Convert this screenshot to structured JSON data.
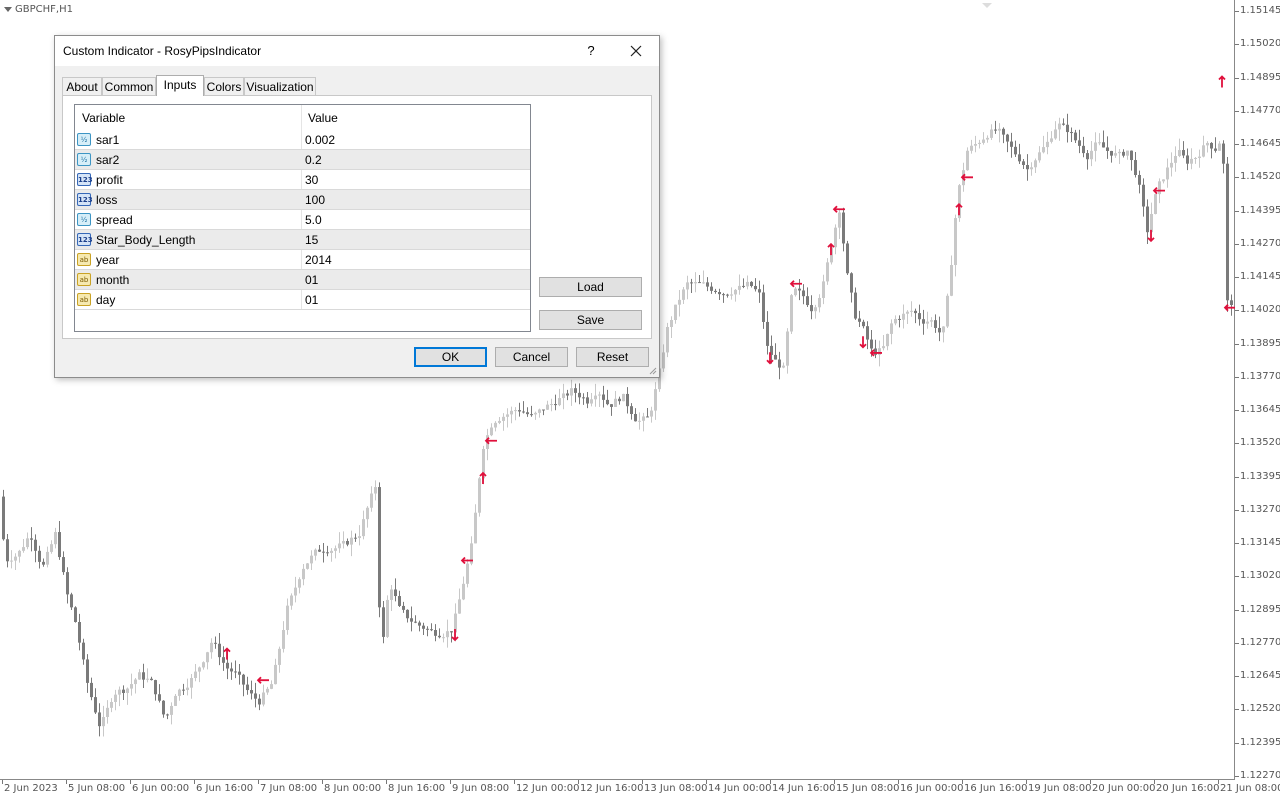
{
  "chart": {
    "symbol": "GBPCHF,H1",
    "price_labels": [
      "1.15145",
      "1.15020",
      "1.14895",
      "1.14770",
      "1.14645",
      "1.14520",
      "1.14395",
      "1.14270",
      "1.14145",
      "1.14020",
      "1.13895",
      "1.13770",
      "1.13645",
      "1.13520",
      "1.13395",
      "1.13270",
      "1.13145",
      "1.13020",
      "1.12895",
      "1.12770",
      "1.12645",
      "1.12520",
      "1.12395",
      "1.12270"
    ],
    "time_labels": [
      "2 Jun 2023",
      "5 Jun 08:00",
      "6 Jun 00:00",
      "6 Jun 16:00",
      "7 Jun 08:00",
      "8 Jun 00:00",
      "8 Jun 16:00",
      "9 Jun 08:00",
      "12 Jun 00:00",
      "12 Jun 16:00",
      "13 Jun 08:00",
      "14 Jun 00:00",
      "14 Jun 16:00",
      "15 Jun 08:00",
      "16 Jun 00:00",
      "16 Jun 16:00",
      "19 Jun 08:00",
      "20 Jun 00:00",
      "20 Jun 16:00",
      "21 Jun 08:00"
    ],
    "colors": {
      "bull": "#c8c8c8",
      "bear": "#7a7a7a",
      "arrow": "#e0103c",
      "grid_line": "#777777"
    },
    "price_path": [
      [
        0,
        1.134
      ],
      [
        8,
        1.1308
      ],
      [
        20,
        1.131
      ],
      [
        33,
        1.1318
      ],
      [
        45,
        1.1305
      ],
      [
        58,
        1.1318
      ],
      [
        70,
        1.1295
      ],
      [
        78,
        1.1285
      ],
      [
        90,
        1.1262
      ],
      [
        103,
        1.1245
      ],
      [
        116,
        1.1258
      ],
      [
        130,
        1.126
      ],
      [
        142,
        1.1265
      ],
      [
        155,
        1.1262
      ],
      [
        168,
        1.1248
      ],
      [
        178,
        1.1258
      ],
      [
        192,
        1.1262
      ],
      [
        205,
        1.127
      ],
      [
        215,
        1.1278
      ],
      [
        228,
        1.1268
      ],
      [
        240,
        1.1265
      ],
      [
        252,
        1.1258
      ],
      [
        262,
        1.1255
      ],
      [
        275,
        1.1262
      ],
      [
        290,
        1.129
      ],
      [
        305,
        1.1305
      ],
      [
        320,
        1.1312
      ],
      [
        335,
        1.1312
      ],
      [
        350,
        1.1315
      ],
      [
        362,
        1.1318
      ],
      [
        372,
        1.133
      ],
      [
        380,
        1.1338
      ],
      [
        383,
        1.1268
      ],
      [
        392,
        1.13
      ],
      [
        402,
        1.129
      ],
      [
        415,
        1.1285
      ],
      [
        430,
        1.1282
      ],
      [
        445,
        1.128
      ],
      [
        455,
        1.1282
      ],
      [
        465,
        1.1298
      ],
      [
        475,
        1.1315
      ],
      [
        485,
        1.135
      ],
      [
        495,
        1.136
      ],
      [
        505,
        1.1362
      ],
      [
        520,
        1.1365
      ],
      [
        535,
        1.1362
      ],
      [
        545,
        1.1365
      ],
      [
        560,
        1.1368
      ],
      [
        575,
        1.1372
      ],
      [
        590,
        1.1368
      ],
      [
        600,
        1.1372
      ],
      [
        612,
        1.1366
      ],
      [
        625,
        1.137
      ],
      [
        640,
        1.136
      ],
      [
        652,
        1.1362
      ],
      [
        660,
        1.1375
      ],
      [
        670,
        1.1395
      ],
      [
        680,
        1.1405
      ],
      [
        690,
        1.1412
      ],
      [
        705,
        1.1412
      ],
      [
        715,
        1.141
      ],
      [
        728,
        1.1408
      ],
      [
        740,
        1.141
      ],
      [
        752,
        1.1412
      ],
      [
        762,
        1.1408
      ],
      [
        770,
        1.1388
      ],
      [
        778,
        1.1383
      ],
      [
        786,
        1.138
      ],
      [
        795,
        1.141
      ],
      [
        805,
        1.1408
      ],
      [
        815,
        1.1402
      ],
      [
        825,
        1.141
      ],
      [
        833,
        1.1425
      ],
      [
        842,
        1.144
      ],
      [
        850,
        1.1415
      ],
      [
        858,
        1.14
      ],
      [
        866,
        1.1395
      ],
      [
        875,
        1.1386
      ],
      [
        885,
        1.1387
      ],
      [
        895,
        1.1398
      ],
      [
        905,
        1.14
      ],
      [
        915,
        1.1402
      ],
      [
        925,
        1.1398
      ],
      [
        935,
        1.1398
      ],
      [
        945,
        1.1392
      ],
      [
        952,
        1.1412
      ],
      [
        960,
        1.1445
      ],
      [
        970,
        1.1462
      ],
      [
        980,
        1.1465
      ],
      [
        990,
        1.1468
      ],
      [
        1000,
        1.147
      ],
      [
        1010,
        1.1465
      ],
      [
        1020,
        1.146
      ],
      [
        1030,
        1.1455
      ],
      [
        1040,
        1.146
      ],
      [
        1050,
        1.1465
      ],
      [
        1060,
        1.1472
      ],
      [
        1070,
        1.147
      ],
      [
        1080,
        1.1465
      ],
      [
        1090,
        1.146
      ],
      [
        1100,
        1.1465
      ],
      [
        1110,
        1.1462
      ],
      [
        1120,
        1.146
      ],
      [
        1130,
        1.1462
      ],
      [
        1140,
        1.1452
      ],
      [
        1150,
        1.1432
      ],
      [
        1160,
        1.1448
      ],
      [
        1170,
        1.1455
      ],
      [
        1180,
        1.1462
      ],
      [
        1190,
        1.1458
      ],
      [
        1200,
        1.146
      ],
      [
        1210,
        1.1465
      ],
      [
        1220,
        1.1462
      ],
      [
        1225,
        1.147
      ],
      [
        1228,
        1.143
      ],
      [
        1230,
        1.1405
      ]
    ],
    "arrows": [
      {
        "t": 227,
        "p": 1.1273,
        "dir": "up"
      },
      {
        "t": 263,
        "p": 1.1263,
        "dir": "left"
      },
      {
        "t": 455,
        "p": 1.128,
        "dir": "down"
      },
      {
        "t": 467,
        "p": 1.1308,
        "dir": "left"
      },
      {
        "t": 483,
        "p": 1.1339,
        "dir": "up"
      },
      {
        "t": 491,
        "p": 1.1353,
        "dir": "left"
      },
      {
        "t": 770,
        "p": 1.1384,
        "dir": "down"
      },
      {
        "t": 796,
        "p": 1.1412,
        "dir": "left"
      },
      {
        "t": 831,
        "p": 1.1425,
        "dir": "up"
      },
      {
        "t": 839,
        "p": 1.144,
        "dir": "left"
      },
      {
        "t": 863,
        "p": 1.139,
        "dir": "down"
      },
      {
        "t": 876,
        "p": 1.1386,
        "dir": "left"
      },
      {
        "t": 959,
        "p": 1.144,
        "dir": "up"
      },
      {
        "t": 967,
        "p": 1.1452,
        "dir": "left"
      },
      {
        "t": 1151,
        "p": 1.143,
        "dir": "down"
      },
      {
        "t": 1159,
        "p": 1.1447,
        "dir": "left"
      },
      {
        "t": 1222,
        "p": 1.1488,
        "dir": "up"
      },
      {
        "t": 1230,
        "p": 1.1403,
        "dir": "left"
      }
    ]
  },
  "dialog": {
    "title": "Custom Indicator - RosyPipsIndicator",
    "help_label": "?",
    "tabs": [
      "About",
      "Common",
      "Inputs",
      "Colors",
      "Visualization"
    ],
    "active_tab": "Inputs",
    "grid": {
      "headers": {
        "variable": "Variable",
        "value": "Value"
      },
      "rows": [
        {
          "icon": "double-type-icon",
          "type_badge": "½",
          "variable": "sar1",
          "value": "0.002"
        },
        {
          "icon": "double-type-icon",
          "type_badge": "½",
          "variable": "sar2",
          "value": "0.2"
        },
        {
          "icon": "integer-type-icon",
          "type_badge": "123",
          "variable": "profit",
          "value": "30"
        },
        {
          "icon": "integer-type-icon",
          "type_badge": "123",
          "variable": "loss",
          "value": "100"
        },
        {
          "icon": "double-type-icon",
          "type_badge": "½",
          "variable": "spread",
          "value": "5.0"
        },
        {
          "icon": "integer-type-icon",
          "type_badge": "123",
          "variable": "Star_Body_Length",
          "value": "15"
        },
        {
          "icon": "string-type-icon",
          "type_badge": "ab",
          "variable": "year",
          "value": "2014"
        },
        {
          "icon": "string-type-icon",
          "type_badge": "ab",
          "variable": "month",
          "value": "01"
        },
        {
          "icon": "string-type-icon",
          "type_badge": "ab",
          "variable": "day",
          "value": "01"
        }
      ]
    },
    "buttons": {
      "load": "Load",
      "save": "Save",
      "ok": "OK",
      "cancel": "Cancel",
      "reset": "Reset"
    }
  }
}
